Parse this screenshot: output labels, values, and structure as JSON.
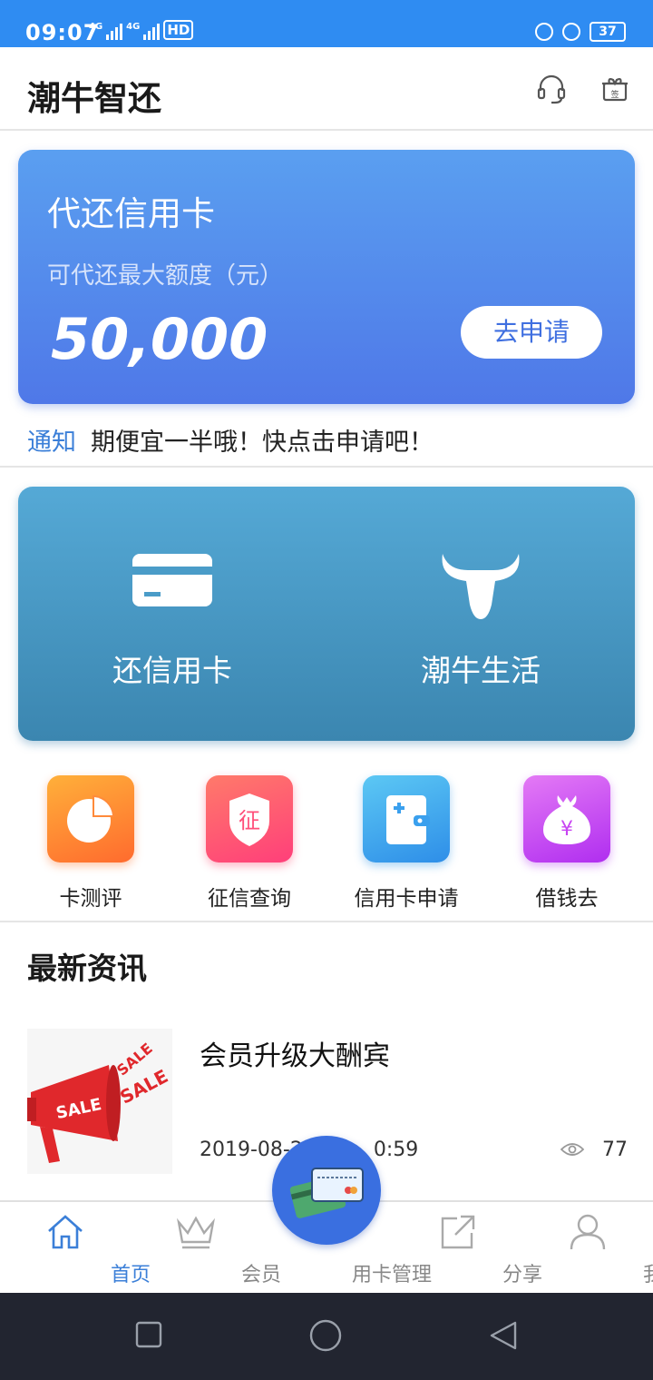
{
  "status_bar": {
    "time": "09:07",
    "signal1_label": "4G",
    "signal2_label": "4G",
    "hd_label": "HD",
    "battery": "37"
  },
  "header": {
    "title": "潮牛智还",
    "icons": [
      "headset-icon",
      "gift-sign-icon"
    ]
  },
  "repay_card": {
    "title": "代还信用卡",
    "subtitle": "可代还最大额度（元）",
    "amount": "50,000",
    "button": "去申请"
  },
  "notice": {
    "label": "通知",
    "text": "期便宜一半哦！快点击申请吧！"
  },
  "services": [
    {
      "label": "还信用卡",
      "icon": "credit-card-icon"
    },
    {
      "label": "潮牛生活",
      "icon": "bull-head-icon"
    }
  ],
  "quick_actions": [
    {
      "label": "卡测评",
      "icon": "pie-chart-icon",
      "color": "#ff7a2e"
    },
    {
      "label": "征信查询",
      "icon": "shield-zheng-icon",
      "color": "#ff4f7a"
    },
    {
      "label": "信用卡申请",
      "icon": "wallet-icon",
      "color": "#3aa8ef"
    },
    {
      "label": "借钱去",
      "icon": "money-bag-icon",
      "color": "#c844f2"
    }
  ],
  "news": {
    "section_title": "最新资讯",
    "items": [
      {
        "title": "会员升级大酬宾",
        "date": "2019-08-2",
        "time_suffix": "0:59",
        "views": "77",
        "thumb_texts": [
          "SALE",
          "SALE",
          "SALE"
        ]
      }
    ]
  },
  "bottom_nav": [
    {
      "label": "首页",
      "icon": "home-icon",
      "active": true
    },
    {
      "label": "会员",
      "icon": "crown-icon",
      "active": false
    },
    {
      "label": "用卡管理",
      "icon": "cards-icon",
      "active": false
    },
    {
      "label": "分享",
      "icon": "share-icon",
      "active": false
    },
    {
      "label": "我",
      "icon": "user-icon",
      "active": false
    }
  ],
  "colors": {
    "status_bar": "#2f8cf2",
    "accent": "#3b7fd8",
    "card_blue": "#5a8ef0",
    "card_teal": "#4a9cc8"
  }
}
